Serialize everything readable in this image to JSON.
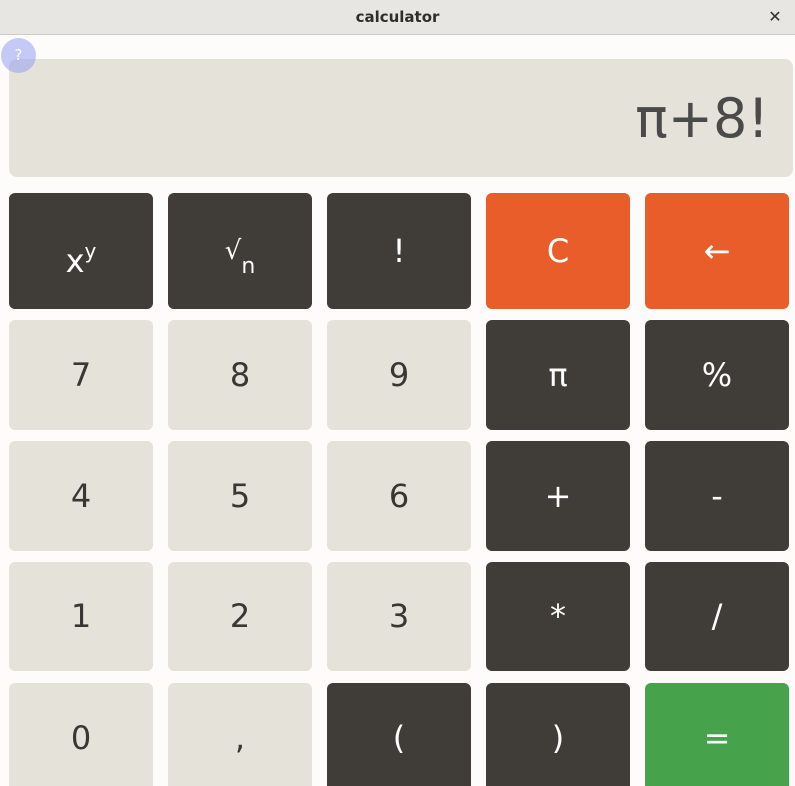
{
  "window": {
    "title": "calculator",
    "close_glyph": "✕"
  },
  "help": {
    "label": "?"
  },
  "display": {
    "expression": "π+8!"
  },
  "colors": {
    "light_key": "#e5e2d9",
    "dark_key": "#403c38",
    "clear_key": "#e95d2a",
    "equals_key": "#46a34b",
    "display_bg": "#e5e2d9"
  },
  "keys": {
    "power": {
      "base": "x",
      "exponent": "y"
    },
    "root": {
      "symbol": "√",
      "index": "n"
    },
    "factorial": "!",
    "clear": "C",
    "backspace": "←",
    "seven": "7",
    "eight": "8",
    "nine": "9",
    "pi": "π",
    "percent": "%",
    "four": "4",
    "five": "5",
    "six": "6",
    "plus": "+",
    "minus": "-",
    "one": "1",
    "two": "2",
    "three": "3",
    "multiply": "*",
    "divide": "/",
    "zero": "0",
    "comma": ",",
    "lparen": "(",
    "rparen": ")",
    "equals": "="
  }
}
